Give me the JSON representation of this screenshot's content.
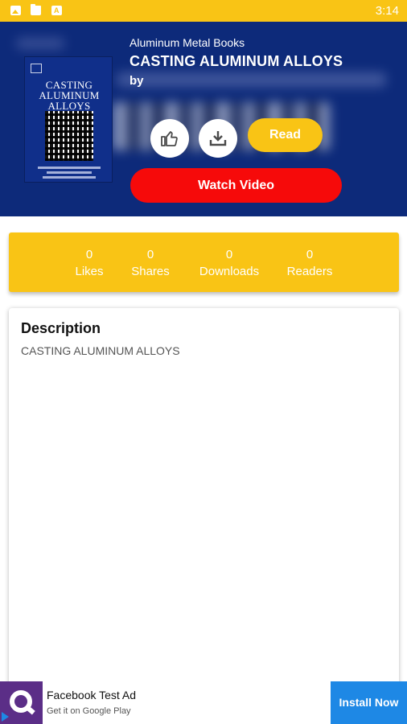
{
  "status_bar": {
    "time": "3:14",
    "icons": [
      "image-notification-icon",
      "folder-notification-icon",
      "document-notification-icon"
    ],
    "color": "#F9C415"
  },
  "book": {
    "series": "Aluminum Metal Books",
    "title": "CASTING ALUMINUM ALLOYS",
    "by_label": "by",
    "cover_title_lines": [
      "CASTING",
      "ALUMINUM",
      "ALLOYS"
    ]
  },
  "actions": {
    "like_icon": "thumbs-up-icon",
    "download_icon": "download-icon",
    "read_label": "Read",
    "watch_label": "Watch Video"
  },
  "stats": [
    {
      "value": "0",
      "label": "Likes"
    },
    {
      "value": "0",
      "label": "Shares"
    },
    {
      "value": "0",
      "label": "Downloads"
    },
    {
      "value": "0",
      "label": "Readers"
    }
  ],
  "description": {
    "heading": "Description",
    "text": "CASTING ALUMINUM ALLOYS"
  },
  "ad": {
    "title": "Facebook Test Ad",
    "subtitle": "Get it on Google Play",
    "cta": "Install Now"
  },
  "colors": {
    "header_bg": "#0D2A7A",
    "accent_yellow": "#F9C415",
    "watch_red": "#F60A0A",
    "install_blue": "#1E88E5",
    "ad_icon_purple": "#5B2E87"
  }
}
